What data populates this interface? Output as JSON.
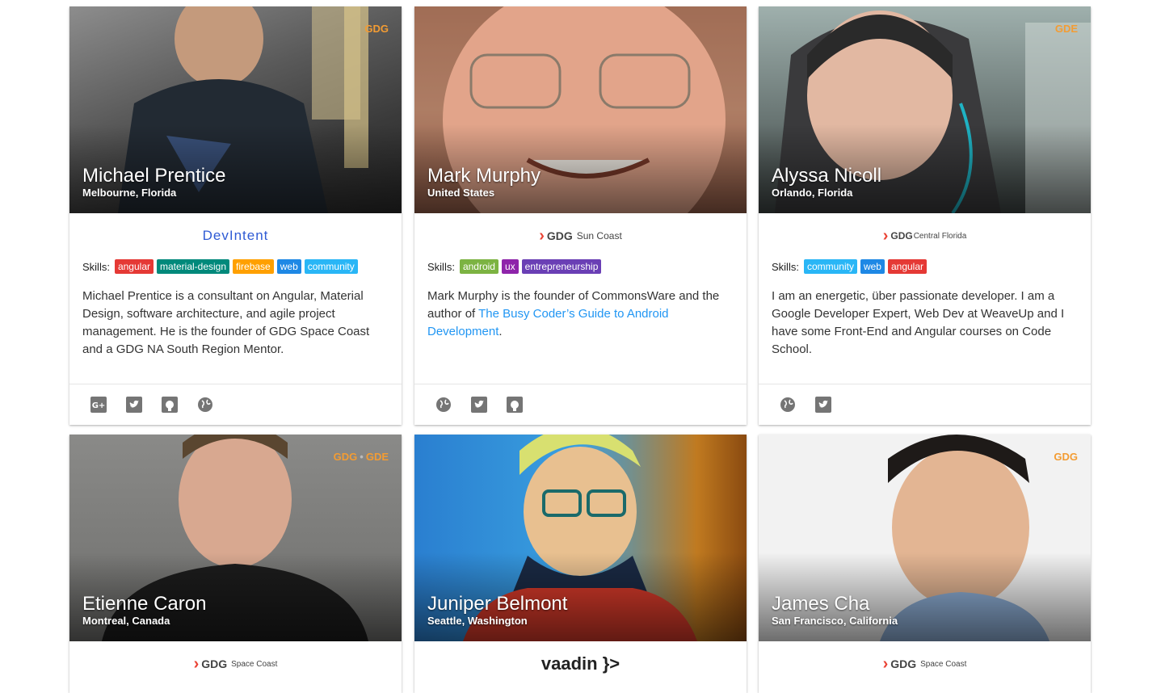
{
  "colors": {
    "badge": "#f39c33",
    "link": "#2196f3",
    "tag_angular": "#e53935",
    "tag_material": "#00897b",
    "tag_firebase": "#ffa000",
    "tag_web": "#1e88e5",
    "tag_community": "#29b6f6",
    "tag_android": "#7cb342",
    "tag_ux": "#8e24aa",
    "tag_entrepreneurship": "#6a3fb5"
  },
  "cards": [
    {
      "name": "Michael Prentice",
      "location": "Melbourne, Florida",
      "badges": [
        "GDG"
      ],
      "org": "DevIntent",
      "skills_label": "Skills:",
      "skills": [
        "angular",
        "material-design",
        "firebase",
        "web",
        "community"
      ],
      "bio": "Michael Prentice is a consultant on Angular, Material Design, software architecture, and agile project management. He is the founder of GDG Space Coast and a GDG NA South Region Mentor.",
      "social": [
        "google-plus-icon",
        "twitter-icon",
        "github-icon",
        "website-icon"
      ]
    },
    {
      "name": "Mark Murphy",
      "location": "United States",
      "badges": [],
      "org_gdg": "GDG",
      "org_chapter": "Sun Coast",
      "skills_label": "Skills:",
      "skills": [
        "android",
        "ux",
        "entrepreneurship"
      ],
      "bio_pre": "Mark Murphy is the founder of CommonsWare and the author of ",
      "bio_link": "The Busy Coder’s Guide to Android Development",
      "bio_post": ".",
      "social": [
        "website-icon",
        "twitter-icon",
        "github-icon"
      ]
    },
    {
      "name": "Alyssa Nicoll",
      "location": "Orlando, Florida",
      "badges": [
        "GDE"
      ],
      "org_gdg": "GDG",
      "org_chapter": "Central Florida",
      "skills_label": "Skills:",
      "skills": [
        "community",
        "web",
        "angular"
      ],
      "bio": "I am an energetic, über passionate developer. I am a Google Developer Expert, Web Dev at WeaveUp and I have some Front-End and Angular courses on Code School.",
      "social": [
        "website-icon",
        "twitter-icon"
      ]
    },
    {
      "name": "Etienne Caron",
      "location": "Montreal, Canada",
      "badge1": "GDG",
      "badge_sep": "•",
      "badge2": "GDE",
      "org_gdg": "GDG",
      "org_chapter": "Space Coast"
    },
    {
      "name": "Juniper Belmont",
      "location": "Seattle, Washington",
      "org": "vaadin }>"
    },
    {
      "name": "James Cha",
      "location": "San Francisco, California",
      "badge1": "GDG",
      "org_gdg": "GDG",
      "org_chapter": "Space Coast"
    }
  ]
}
